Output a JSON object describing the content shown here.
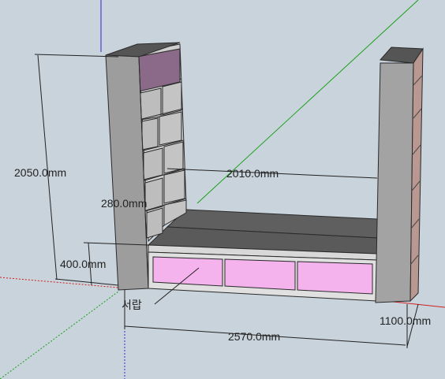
{
  "viewport": {
    "background": "#c9d3db",
    "axes": {
      "blue": "#2a2ad8",
      "green": "#1aa01a",
      "red": "#d02020"
    }
  },
  "model": {
    "panel_color": "#9d9d9d",
    "panel_edge": "#3a3a3a",
    "shelf_color": "#b8b8b8",
    "top_color": "#6a6a6a",
    "drawer_color": "#f5b3ee",
    "top_box_color": "#8a6a88"
  },
  "dimensions": {
    "height": "2050.0mm",
    "inner_width": "2010.0mm",
    "depth_left": "280.0mm",
    "bench_height": "400.0mm",
    "total_width": "2570.0mm",
    "depth_right": "1100.0mm"
  },
  "labels": {
    "drawer": "서랍"
  }
}
